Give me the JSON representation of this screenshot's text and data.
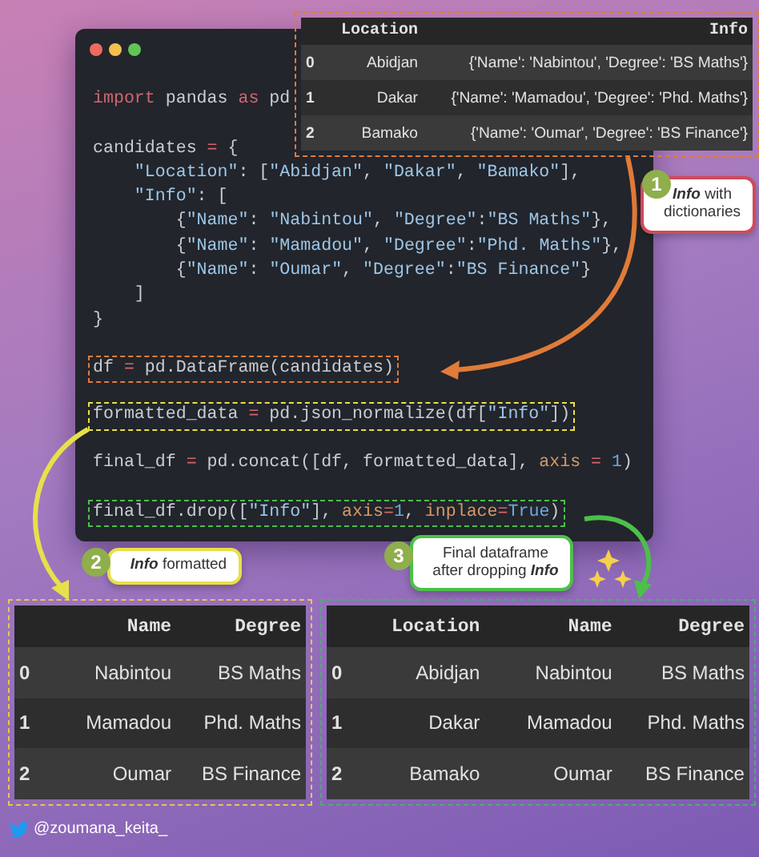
{
  "code_window": {
    "blocks": [
      {
        "lines": [
          [
            {
              "kind": "keyword",
              "text": "import"
            },
            {
              "kind": "plain",
              "text": " pandas "
            },
            {
              "kind": "keyword",
              "text": "as"
            },
            {
              "kind": "plain",
              "text": " pd"
            }
          ]
        ]
      },
      {
        "lines": [
          [
            {
              "kind": "plain",
              "text": "candidates "
            },
            {
              "kind": "op",
              "text": "="
            },
            {
              "kind": "plain",
              "text": " {"
            }
          ],
          [
            {
              "kind": "string",
              "text": "    \"Location\""
            },
            {
              "kind": "plain",
              "text": ": ["
            },
            {
              "kind": "string",
              "text": "\"Abidjan\""
            },
            {
              "kind": "plain",
              "text": ", "
            },
            {
              "kind": "string",
              "text": "\"Dakar\""
            },
            {
              "kind": "plain",
              "text": ", "
            },
            {
              "kind": "string",
              "text": "\"Bamako\""
            },
            {
              "kind": "plain",
              "text": "],"
            }
          ],
          [
            {
              "kind": "string",
              "text": "    \"Info\""
            },
            {
              "kind": "plain",
              "text": ": ["
            }
          ],
          [
            {
              "kind": "plain",
              "text": "        {"
            },
            {
              "kind": "string",
              "text": "\"Name\""
            },
            {
              "kind": "plain",
              "text": ": "
            },
            {
              "kind": "string",
              "text": "\"Nabintou\""
            },
            {
              "kind": "plain",
              "text": ", "
            },
            {
              "kind": "string",
              "text": "\"Degree\""
            },
            {
              "kind": "plain",
              "text": ":"
            },
            {
              "kind": "string",
              "text": "\"BS Maths\""
            },
            {
              "kind": "plain",
              "text": "},"
            }
          ],
          [
            {
              "kind": "plain",
              "text": "        {"
            },
            {
              "kind": "string",
              "text": "\"Name\""
            },
            {
              "kind": "plain",
              "text": ": "
            },
            {
              "kind": "string",
              "text": "\"Mamadou\""
            },
            {
              "kind": "plain",
              "text": ", "
            },
            {
              "kind": "string",
              "text": "\"Degree\""
            },
            {
              "kind": "plain",
              "text": ":"
            },
            {
              "kind": "string",
              "text": "\"Phd. Maths\""
            },
            {
              "kind": "plain",
              "text": "},"
            }
          ],
          [
            {
              "kind": "plain",
              "text": "        {"
            },
            {
              "kind": "string",
              "text": "\"Name\""
            },
            {
              "kind": "plain",
              "text": ": "
            },
            {
              "kind": "string",
              "text": "\"Oumar\""
            },
            {
              "kind": "plain",
              "text": ", "
            },
            {
              "kind": "string",
              "text": "\"Degree\""
            },
            {
              "kind": "plain",
              "text": ":"
            },
            {
              "kind": "string",
              "text": "\"BS Finance\""
            },
            {
              "kind": "plain",
              "text": "}"
            }
          ],
          [
            {
              "kind": "plain",
              "text": "    ]"
            }
          ],
          [
            {
              "kind": "plain",
              "text": "}"
            }
          ]
        ]
      },
      {
        "color": "#e07b39",
        "lines": [
          [
            {
              "kind": "plain",
              "text": "df "
            },
            {
              "kind": "op",
              "text": "="
            },
            {
              "kind": "plain",
              "text": " pd.DataFrame(candidates)"
            }
          ]
        ]
      },
      {
        "color": "#e8e04a",
        "lines": [
          [
            {
              "kind": "plain",
              "text": "formatted_data "
            },
            {
              "kind": "op",
              "text": "="
            },
            {
              "kind": "plain",
              "text": " pd.json_normalize(df["
            },
            {
              "kind": "string",
              "text": "\"Info\""
            },
            {
              "kind": "plain",
              "text": "])"
            }
          ]
        ]
      },
      {
        "lines": [
          [
            {
              "kind": "plain",
              "text": "final_df "
            },
            {
              "kind": "op",
              "text": "="
            },
            {
              "kind": "plain",
              "text": " pd.concat([df, formatted_data], "
            },
            {
              "kind": "param",
              "text": "axis"
            },
            {
              "kind": "op",
              "text": " = "
            },
            {
              "kind": "number",
              "text": "1"
            },
            {
              "kind": "plain",
              "text": ")"
            }
          ]
        ]
      },
      {
        "color": "#4cc04a",
        "lines": [
          [
            {
              "kind": "plain",
              "text": "final_df.drop(["
            },
            {
              "kind": "string",
              "text": "\"Info\""
            },
            {
              "kind": "plain",
              "text": "], "
            },
            {
              "kind": "param",
              "text": "axis"
            },
            {
              "kind": "op",
              "text": "="
            },
            {
              "kind": "number",
              "text": "1"
            },
            {
              "kind": "plain",
              "text": ", "
            },
            {
              "kind": "param",
              "text": "inplace"
            },
            {
              "kind": "op",
              "text": "="
            },
            {
              "kind": "number",
              "text": "True"
            },
            {
              "kind": "plain",
              "text": ")"
            }
          ]
        ]
      }
    ]
  },
  "tables": [
    {
      "color": "#e07b39",
      "columns": [
        "Location",
        "Info"
      ],
      "rows": [
        {
          "index": "0",
          "cells": [
            "Abidjan",
            "{'Name': 'Nabintou', 'Degree': 'BS Maths'}"
          ]
        },
        {
          "index": "1",
          "cells": [
            "Dakar",
            "{'Name': 'Mamadou', 'Degree': 'Phd. Maths'}"
          ]
        },
        {
          "index": "2",
          "cells": [
            "Bamako",
            "{'Name': 'Oumar', 'Degree': 'BS Finance'}"
          ]
        }
      ]
    },
    {
      "color": "#e8c84a",
      "columns": [
        "Name",
        "Degree"
      ],
      "rows": [
        {
          "index": "0",
          "cells": [
            "Nabintou",
            "BS Maths"
          ]
        },
        {
          "index": "1",
          "cells": [
            "Mamadou",
            "Phd. Maths"
          ]
        },
        {
          "index": "2",
          "cells": [
            "Oumar",
            "BS Finance"
          ]
        }
      ]
    },
    {
      "color": "#4caf6a",
      "columns": [
        "Location",
        "Name",
        "Degree"
      ],
      "rows": [
        {
          "index": "0",
          "cells": [
            "Abidjan",
            "Nabintou",
            "BS Maths"
          ]
        },
        {
          "index": "1",
          "cells": [
            "Dakar",
            "Mamadou",
            "Phd. Maths"
          ]
        },
        {
          "index": "2",
          "cells": [
            "Bamako",
            "Oumar",
            "BS Finance"
          ]
        }
      ]
    }
  ],
  "callouts": [
    {
      "number": "1",
      "text": "**Info** with dictionaries",
      "color": "#d04a5a"
    },
    {
      "number": "2",
      "text": "**Info** formatted",
      "color": "#e8e04a"
    },
    {
      "number": "3",
      "text": "Final dataframe after dropping **Info**",
      "color": "#4cc04a"
    }
  ],
  "handle": "@zoumana_keita_"
}
